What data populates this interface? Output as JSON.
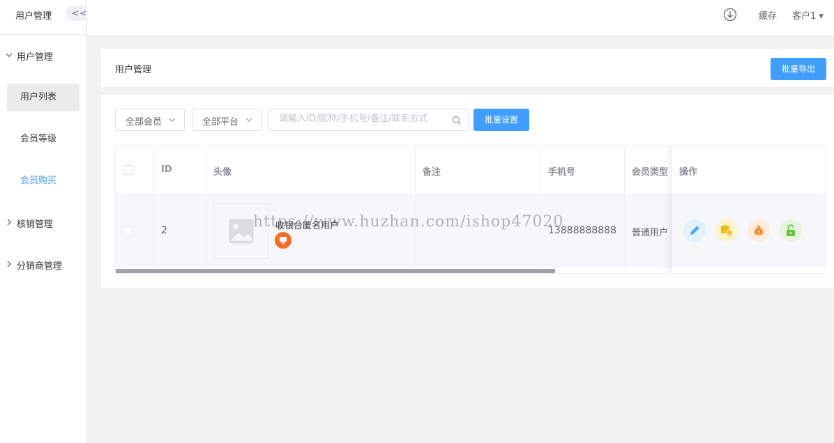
{
  "header": {
    "sys_title": "用户管理",
    "collapse_label": "<<",
    "cache": "缓存",
    "user": "客户1"
  },
  "sidebar": {
    "groups": [
      {
        "label": "用户管理",
        "expanded": true
      },
      {
        "label": "核销管理",
        "expanded": false
      },
      {
        "label": "分销商管理",
        "expanded": false
      }
    ],
    "items": [
      {
        "label": "用户列表",
        "state": "active"
      },
      {
        "label": "会员等级",
        "state": "normal"
      },
      {
        "label": "会员购买",
        "state": "link"
      }
    ]
  },
  "page": {
    "title": "用户管理",
    "export_button": "批量导出"
  },
  "filters": {
    "member_select": "全部会员",
    "platform_select": "全部平台",
    "search_placeholder": "请输入ID/昵称/手机号/备注/联系方式",
    "batch_button": "批量设置"
  },
  "table": {
    "columns": [
      "ID",
      "头像",
      "备注",
      "手机号",
      "会员类型",
      "操作"
    ],
    "rows": [
      {
        "id": "2",
        "nickname": "收银台匿名用户",
        "note": "",
        "phone": "13888888888",
        "member_type": "普通用户"
      }
    ]
  },
  "operations": [
    "edit-icon",
    "coins-icon",
    "money-bag-icon",
    "unlock-icon"
  ],
  "watermark": "https://www.huzhan.com/ishop47020",
  "colors": {
    "primary": "#409eff",
    "orange": "#f56c23",
    "yellow": "#f5c518",
    "green": "#67c23a"
  }
}
